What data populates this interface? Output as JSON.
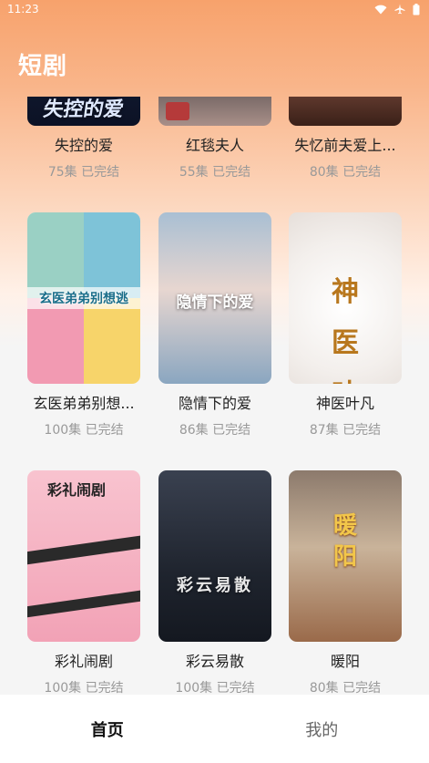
{
  "status_bar": {
    "time": "11:23",
    "icons": [
      "wifi-icon",
      "airplane-icon",
      "battery-icon"
    ]
  },
  "header": {
    "title": "短剧"
  },
  "dramas": [
    {
      "title": "失控的爱",
      "episodes": "75集",
      "status": "已完结",
      "poster_text": "失控的爱"
    },
    {
      "title": "红毯夫人",
      "episodes": "55集",
      "status": "已完结",
      "poster_text": ""
    },
    {
      "title": "失忆前夫爱上...",
      "episodes": "80集",
      "status": "已完结",
      "poster_text": ""
    },
    {
      "title": "玄医弟弟别想...",
      "episodes": "100集",
      "status": "已完结",
      "poster_text": "玄医弟弟别想逃"
    },
    {
      "title": "隐情下的爱",
      "episodes": "86集",
      "status": "已完结",
      "poster_text": "隐情下的爱"
    },
    {
      "title": "神医叶凡",
      "episodes": "87集",
      "status": "已完结",
      "poster_text": "神医 叶凡"
    },
    {
      "title": "彩礼闹剧",
      "episodes": "100集",
      "status": "已完结",
      "poster_text": "彩礼闹剧"
    },
    {
      "title": "彩云易散",
      "episodes": "100集",
      "status": "已完结",
      "poster_text": "彩云易散"
    },
    {
      "title": "暖阳",
      "episodes": "80集",
      "status": "已完结",
      "poster_text": "暖阳"
    }
  ],
  "tabbar": {
    "home_label": "首页",
    "profile_label": "我的"
  },
  "colors": {
    "accent_gradient_top": "#f7a26c",
    "page_bg": "#f5f5f5",
    "meta_text": "#999999"
  }
}
